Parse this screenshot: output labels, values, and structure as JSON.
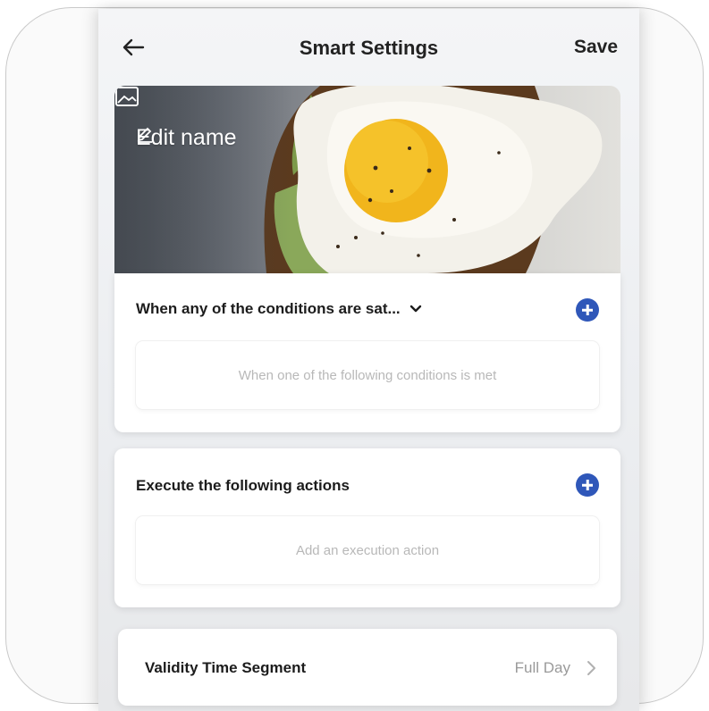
{
  "header": {
    "title": "Smart Settings",
    "save_label": "Save",
    "back_icon": "back-arrow-icon"
  },
  "banner": {
    "edit_name_label": "Edit name",
    "edit_icon": "pencil-icon",
    "image_icon": "image-icon"
  },
  "conditions": {
    "title": "When any of the conditions are sat...",
    "dropdown_icon": "chevron-down-icon",
    "add_icon": "add-circle-icon",
    "placeholder": "When one of the following conditions is met"
  },
  "actions": {
    "title": "Execute the following actions",
    "add_icon": "add-circle-icon",
    "placeholder": "Add an execution action"
  },
  "validity": {
    "label": "Validity Time Segment",
    "value": "Full Day",
    "chevron_icon": "chevron-right-icon"
  },
  "colors": {
    "accent": "#2f57b9",
    "text": "#1c1c1c",
    "muted": "#b8b8b8"
  }
}
